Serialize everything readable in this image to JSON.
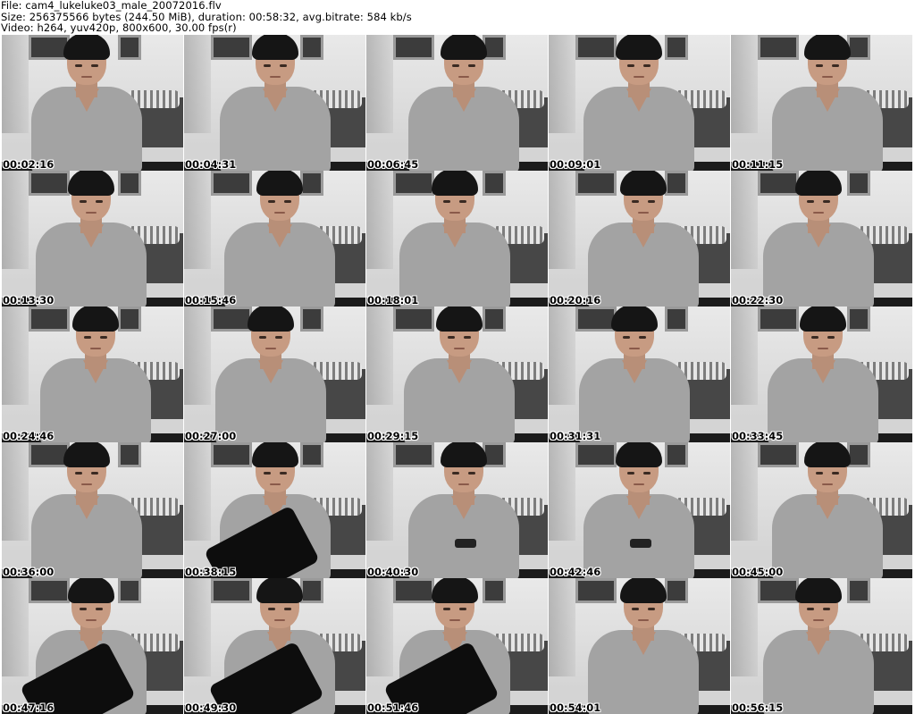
{
  "header": {
    "file_line": "File: cam4_lukeluke03_male_20072016.flv",
    "size_line": "Size: 256375566 bytes (244.50 MiB), duration: 00:58:32, avg.bitrate: 584 kb/s",
    "video_line": "Video: h264, yuv420p, 800x600, 30.00 fps(r)"
  },
  "thumbnails": [
    {
      "time": "00:02:16"
    },
    {
      "time": "00:04:31"
    },
    {
      "time": "00:06:45"
    },
    {
      "time": "00:09:01"
    },
    {
      "time": "00:11:15"
    },
    {
      "time": "00:13:30"
    },
    {
      "time": "00:15:46"
    },
    {
      "time": "00:18:01"
    },
    {
      "time": "00:20:16"
    },
    {
      "time": "00:22:30"
    },
    {
      "time": "00:24:46"
    },
    {
      "time": "00:27:00"
    },
    {
      "time": "00:29:15"
    },
    {
      "time": "00:31:31"
    },
    {
      "time": "00:33:45"
    },
    {
      "time": "00:36:00"
    },
    {
      "time": "00:38:15"
    },
    {
      "time": "00:40:30"
    },
    {
      "time": "00:42:46"
    },
    {
      "time": "00:45:00"
    },
    {
      "time": "00:47:16"
    },
    {
      "time": "00:49:30"
    },
    {
      "time": "00:51:46"
    },
    {
      "time": "00:54:01"
    },
    {
      "time": "00:56:15"
    }
  ]
}
